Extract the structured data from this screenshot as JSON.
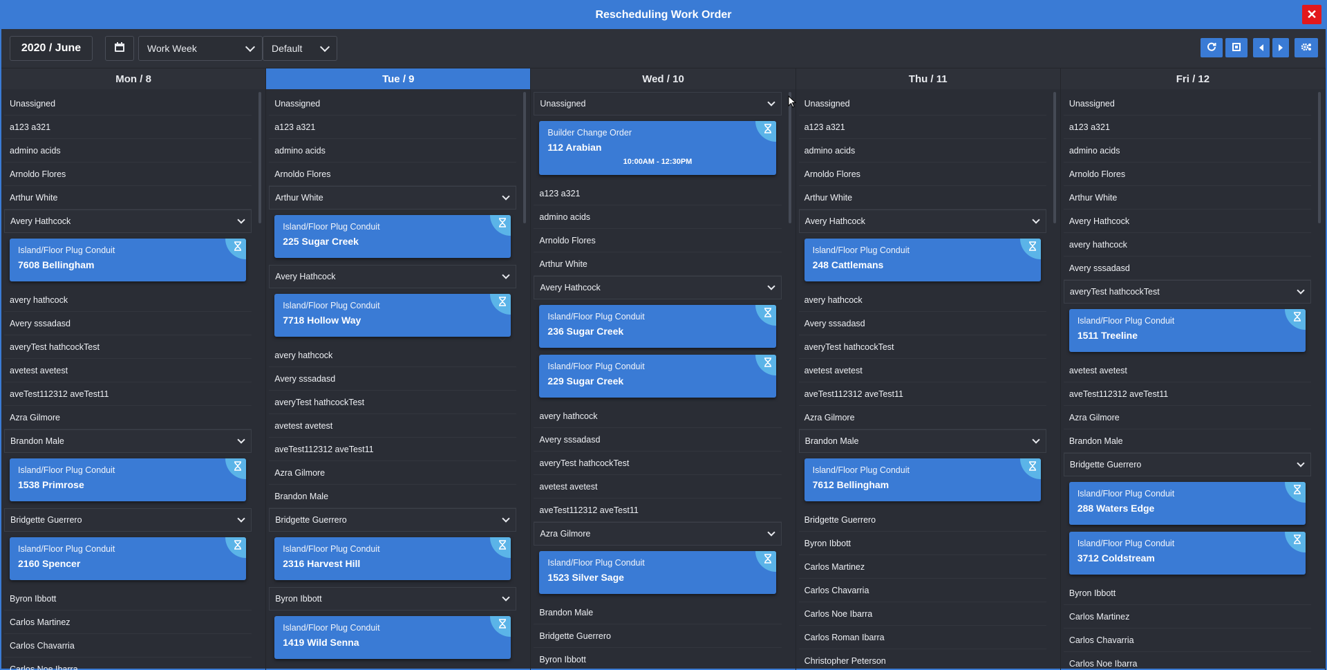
{
  "window": {
    "title": "Rescheduling Work Order",
    "close": "✕"
  },
  "toolbar": {
    "month": "2020 / June",
    "view_select": "Work Week",
    "filter_select": "Default",
    "calendar_icon": "calendar-icon",
    "buttons": [
      "refresh-icon",
      "fit-icon",
      "prev-icon",
      "next-icon",
      "settings-icon"
    ]
  },
  "colors": {
    "accent": "#3a7bd5",
    "close": "#e3181c",
    "badge": "#5bb4e8",
    "background": "#2a2d35"
  },
  "days": [
    {
      "header": "Mon / 8",
      "today": false,
      "rows": [
        {
          "t": "row",
          "label": "Unassigned"
        },
        {
          "t": "row",
          "label": "a123 a321"
        },
        {
          "t": "row",
          "label": "admino acids"
        },
        {
          "t": "row",
          "label": "Arnoldo Flores"
        },
        {
          "t": "row",
          "label": "Arthur White"
        },
        {
          "t": "grp",
          "label": "Avery Hathcock"
        },
        {
          "t": "card",
          "type": "Island/Floor Plug Conduit",
          "addr": "7608 Bellingham"
        },
        {
          "t": "row",
          "label": "avery hathcock"
        },
        {
          "t": "row",
          "label": "Avery sssadasd"
        },
        {
          "t": "row",
          "label": "averyTest hathcockTest"
        },
        {
          "t": "row",
          "label": "avetest avetest"
        },
        {
          "t": "row",
          "label": "aveTest112312 aveTest11"
        },
        {
          "t": "row",
          "label": "Azra Gilmore"
        },
        {
          "t": "grp",
          "label": "Brandon Male"
        },
        {
          "t": "card",
          "type": "Island/Floor Plug Conduit",
          "addr": "1538 Primrose"
        },
        {
          "t": "grp",
          "label": "Bridgette Guerrero"
        },
        {
          "t": "card",
          "type": "Island/Floor Plug Conduit",
          "addr": "2160 Spencer"
        },
        {
          "t": "row",
          "label": "Byron Ibbott"
        },
        {
          "t": "row",
          "label": "Carlos Martinez"
        },
        {
          "t": "row",
          "label": "Carlos Chavarria"
        },
        {
          "t": "row",
          "label": "Carlos Noe Ibarra"
        }
      ]
    },
    {
      "header": "Tue / 9",
      "today": true,
      "rows": [
        {
          "t": "row",
          "label": "Unassigned"
        },
        {
          "t": "row",
          "label": "a123 a321"
        },
        {
          "t": "row",
          "label": "admino acids"
        },
        {
          "t": "row",
          "label": "Arnoldo Flores"
        },
        {
          "t": "grp",
          "label": "Arthur White"
        },
        {
          "t": "card",
          "type": "Island/Floor Plug Conduit",
          "addr": "225 Sugar Creek"
        },
        {
          "t": "grp",
          "label": "Avery Hathcock"
        },
        {
          "t": "card",
          "type": "Island/Floor Plug Conduit",
          "addr": "7718 Hollow Way"
        },
        {
          "t": "row",
          "label": "avery hathcock"
        },
        {
          "t": "row",
          "label": "Avery sssadasd"
        },
        {
          "t": "row",
          "label": "averyTest hathcockTest"
        },
        {
          "t": "row",
          "label": "avetest avetest"
        },
        {
          "t": "row",
          "label": "aveTest112312 aveTest11"
        },
        {
          "t": "row",
          "label": "Azra Gilmore"
        },
        {
          "t": "row",
          "label": "Brandon Male"
        },
        {
          "t": "grp",
          "label": "Bridgette Guerrero"
        },
        {
          "t": "card",
          "type": "Island/Floor Plug Conduit",
          "addr": "2316 Harvest Hill"
        },
        {
          "t": "grp",
          "label": "Byron Ibbott"
        },
        {
          "t": "card",
          "type": "Island/Floor Plug Conduit",
          "addr": "1419 Wild Senna"
        }
      ]
    },
    {
      "header": "Wed / 10",
      "today": false,
      "rows": [
        {
          "t": "grp",
          "label": "Unassigned"
        },
        {
          "t": "card",
          "type": "Builder Change Order",
          "addr": "112 Arabian",
          "time": "10:00AM - 12:30PM"
        },
        {
          "t": "row",
          "label": "a123 a321"
        },
        {
          "t": "row",
          "label": "admino acids"
        },
        {
          "t": "row",
          "label": "Arnoldo Flores"
        },
        {
          "t": "row",
          "label": "Arthur White"
        },
        {
          "t": "grp",
          "label": "Avery Hathcock"
        },
        {
          "t": "card",
          "type": "Island/Floor Plug Conduit",
          "addr": "236 Sugar Creek"
        },
        {
          "t": "card",
          "type": "Island/Floor Plug Conduit",
          "addr": "229 Sugar Creek"
        },
        {
          "t": "row",
          "label": "avery hathcock"
        },
        {
          "t": "row",
          "label": "Avery sssadasd"
        },
        {
          "t": "row",
          "label": "averyTest hathcockTest"
        },
        {
          "t": "row",
          "label": "avetest avetest"
        },
        {
          "t": "row",
          "label": "aveTest112312 aveTest11"
        },
        {
          "t": "grp",
          "label": "Azra Gilmore"
        },
        {
          "t": "card",
          "type": "Island/Floor Plug Conduit",
          "addr": "1523 Silver Sage"
        },
        {
          "t": "row",
          "label": "Brandon Male"
        },
        {
          "t": "row",
          "label": "Bridgette Guerrero"
        },
        {
          "t": "row",
          "label": "Byron Ibbott"
        }
      ]
    },
    {
      "header": "Thu / 11",
      "today": false,
      "rows": [
        {
          "t": "row",
          "label": "Unassigned"
        },
        {
          "t": "row",
          "label": "a123 a321"
        },
        {
          "t": "row",
          "label": "admino acids"
        },
        {
          "t": "row",
          "label": "Arnoldo Flores"
        },
        {
          "t": "row",
          "label": "Arthur White"
        },
        {
          "t": "grp",
          "label": "Avery Hathcock"
        },
        {
          "t": "card",
          "type": "Island/Floor Plug Conduit",
          "addr": "248 Cattlemans"
        },
        {
          "t": "row",
          "label": "avery hathcock"
        },
        {
          "t": "row",
          "label": "Avery sssadasd"
        },
        {
          "t": "row",
          "label": "averyTest hathcockTest"
        },
        {
          "t": "row",
          "label": "avetest avetest"
        },
        {
          "t": "row",
          "label": "aveTest112312 aveTest11"
        },
        {
          "t": "row",
          "label": "Azra Gilmore"
        },
        {
          "t": "grp",
          "label": "Brandon Male"
        },
        {
          "t": "card",
          "type": "Island/Floor Plug Conduit",
          "addr": "7612 Bellingham"
        },
        {
          "t": "row",
          "label": "Bridgette Guerrero"
        },
        {
          "t": "row",
          "label": "Byron Ibbott"
        },
        {
          "t": "row",
          "label": "Carlos Martinez"
        },
        {
          "t": "row",
          "label": "Carlos Chavarria"
        },
        {
          "t": "row",
          "label": "Carlos Noe Ibarra"
        },
        {
          "t": "row",
          "label": "Carlos Roman Ibarra"
        },
        {
          "t": "row",
          "label": "Christopher Peterson"
        }
      ]
    },
    {
      "header": "Fri / 12",
      "today": false,
      "rows": [
        {
          "t": "row",
          "label": "Unassigned"
        },
        {
          "t": "row",
          "label": "a123 a321"
        },
        {
          "t": "row",
          "label": "admino acids"
        },
        {
          "t": "row",
          "label": "Arnoldo Flores"
        },
        {
          "t": "row",
          "label": "Arthur White"
        },
        {
          "t": "row",
          "label": "Avery Hathcock"
        },
        {
          "t": "row",
          "label": "avery hathcock"
        },
        {
          "t": "row",
          "label": "Avery sssadasd"
        },
        {
          "t": "grp",
          "label": "averyTest hathcockTest"
        },
        {
          "t": "card",
          "type": "Island/Floor Plug Conduit",
          "addr": "1511 Treeline"
        },
        {
          "t": "row",
          "label": "avetest avetest"
        },
        {
          "t": "row",
          "label": "aveTest112312 aveTest11"
        },
        {
          "t": "row",
          "label": "Azra Gilmore"
        },
        {
          "t": "row",
          "label": "Brandon Male"
        },
        {
          "t": "grp",
          "label": "Bridgette Guerrero"
        },
        {
          "t": "card",
          "type": "Island/Floor Plug Conduit",
          "addr": "288 Waters Edge"
        },
        {
          "t": "card",
          "type": "Island/Floor Plug Conduit",
          "addr": "3712 Coldstream"
        },
        {
          "t": "row",
          "label": "Byron Ibbott"
        },
        {
          "t": "row",
          "label": "Carlos Martinez"
        },
        {
          "t": "row",
          "label": "Carlos Chavarria"
        },
        {
          "t": "row",
          "label": "Carlos Noe Ibarra"
        }
      ]
    }
  ]
}
